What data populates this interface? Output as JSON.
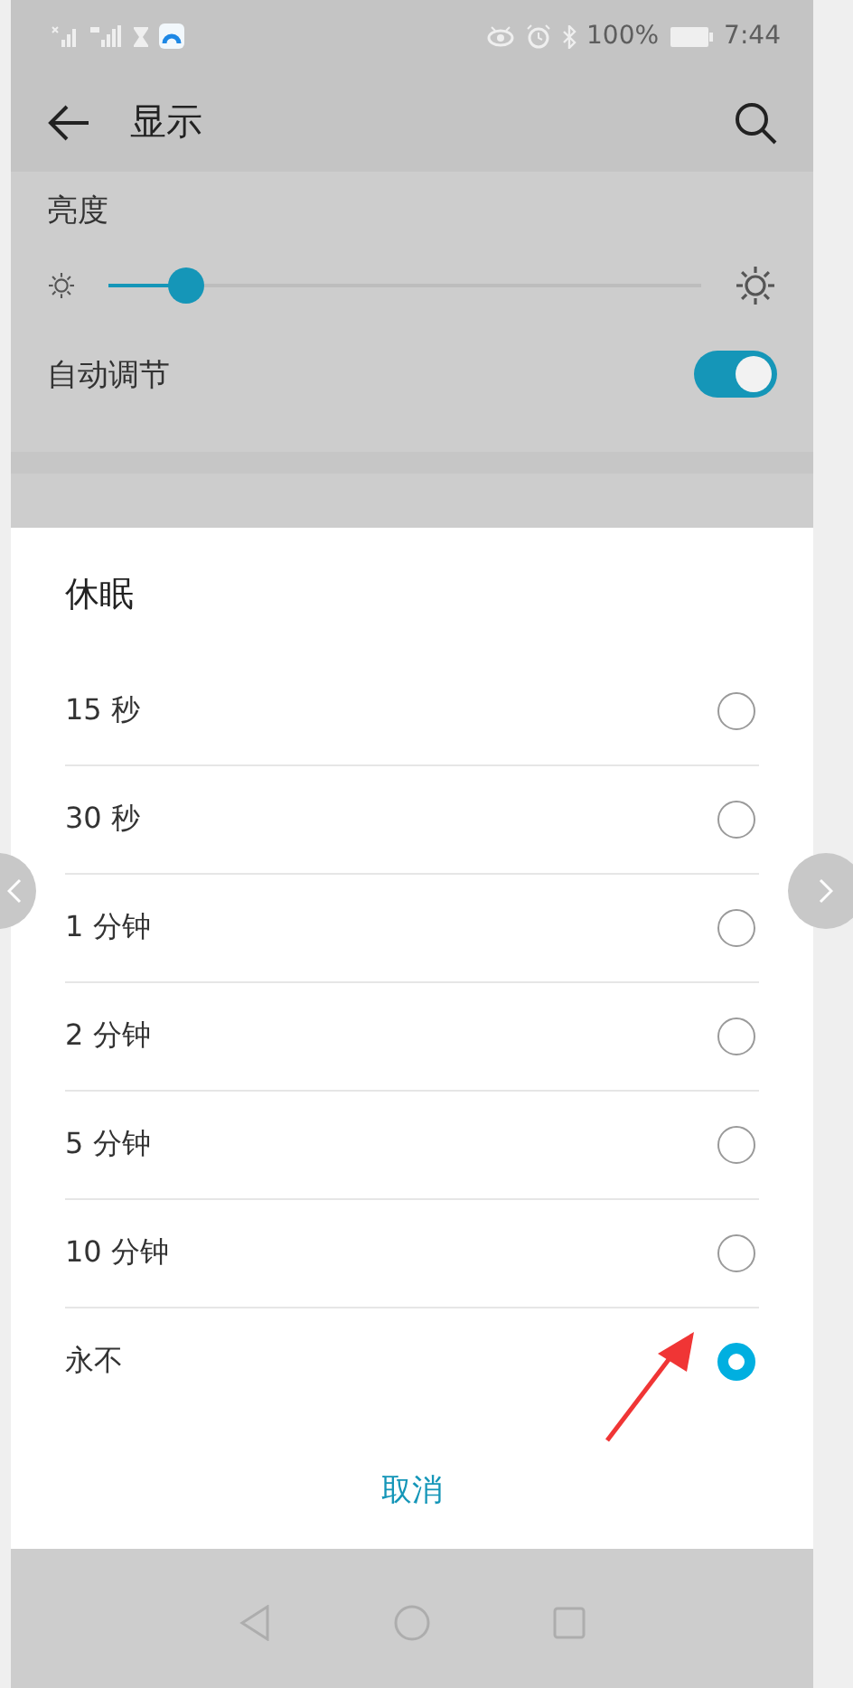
{
  "status_bar": {
    "battery": "100%",
    "time": "7:44"
  },
  "header": {
    "title": "显示"
  },
  "brightness": {
    "label": "亮度",
    "level": 0.13
  },
  "auto_adjust": {
    "label": "自动调节",
    "on": true
  },
  "dialog": {
    "title": "休眠",
    "options": [
      {
        "label": "15 秒",
        "selected": false
      },
      {
        "label": "30 秒",
        "selected": false
      },
      {
        "label": "1 分钟",
        "selected": false
      },
      {
        "label": "2 分钟",
        "selected": false
      },
      {
        "label": "5 分钟",
        "selected": false
      },
      {
        "label": "10 分钟",
        "selected": false
      },
      {
        "label": "永不",
        "selected": true
      }
    ],
    "cancel": "取消"
  }
}
